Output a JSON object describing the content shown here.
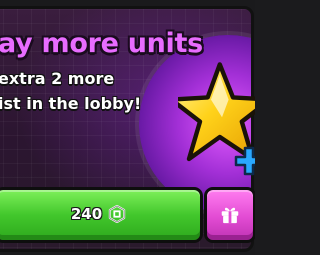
{
  "popup": {
    "title": "ay more units",
    "description_lines": [
      "extra 2 more",
      "ist in the lobby!"
    ]
  },
  "buy_button": {
    "price": "240",
    "currency_icon": "robux-coin-icon"
  },
  "gift_button": {
    "icon": "gift-icon"
  },
  "artwork": {
    "icons": [
      "star-icon",
      "plus-icon"
    ]
  },
  "colors": {
    "title": "#e86cff",
    "buy_button": "#42c72c",
    "gift_button": "#e24bd3",
    "halo": "#a22fd6",
    "star": "#ffd21a",
    "plus": "#29a8ff"
  }
}
